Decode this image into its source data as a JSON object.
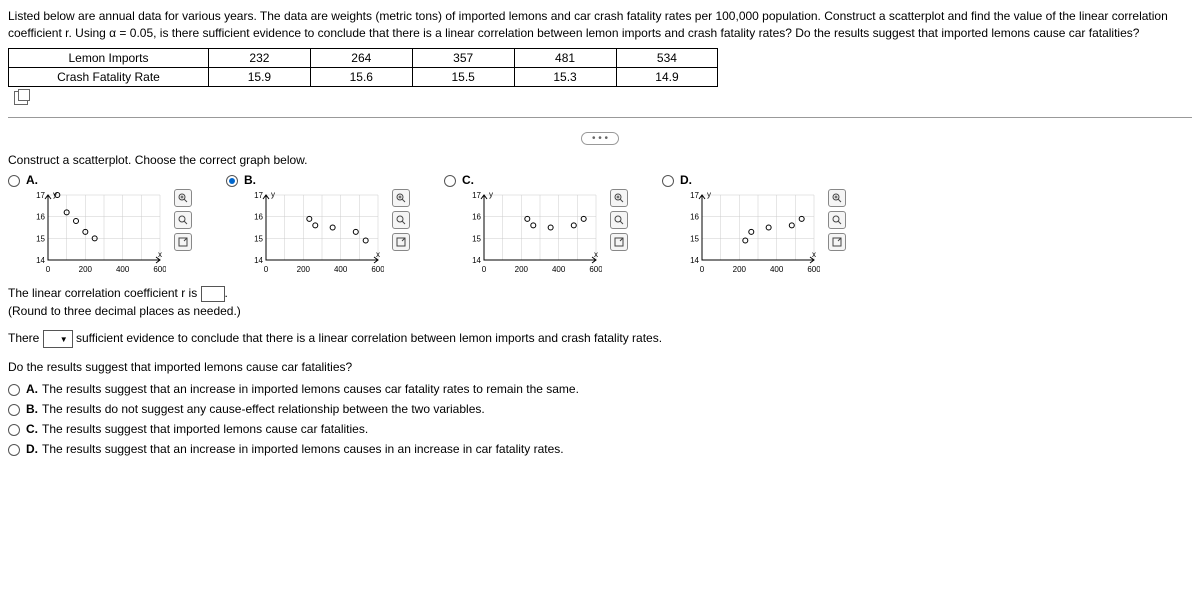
{
  "intro": "Listed below are annual data for various years. The data are weights (metric tons) of imported lemons and car crash fatality rates per 100,000 population. Construct a scatterplot and find the value of the linear correlation coefficient r. Using α = 0.05, is there sufficient evidence to conclude that there is a linear correlation between lemon imports and crash fatality rates? Do the results suggest that imported lemons cause car fatalities?",
  "table": {
    "rows": [
      {
        "label": "Lemon Imports",
        "values": [
          "232",
          "264",
          "357",
          "481",
          "534"
        ]
      },
      {
        "label": "Crash Fatality Rate",
        "values": [
          "15.9",
          "15.6",
          "15.5",
          "15.3",
          "14.9"
        ]
      }
    ]
  },
  "q1": "Construct a scatterplot. Choose the correct graph below.",
  "options": [
    {
      "letter": "A.",
      "selected": false
    },
    {
      "letter": "B.",
      "selected": true
    },
    {
      "letter": "C.",
      "selected": false
    },
    {
      "letter": "D.",
      "selected": false
    }
  ],
  "axis": {
    "y": "y",
    "x": "x",
    "yticks": [
      "17",
      "16",
      "15",
      "14"
    ],
    "xticks": [
      "0",
      "200",
      "400",
      "600"
    ]
  },
  "chart_data": [
    {
      "type": "scatter",
      "title": "A",
      "xlim": [
        0,
        600
      ],
      "ylim": [
        14,
        17
      ],
      "x": [
        50,
        100,
        150,
        200,
        250
      ],
      "y": [
        17,
        16.2,
        15.8,
        15.3,
        15
      ]
    },
    {
      "type": "scatter",
      "title": "B",
      "xlim": [
        0,
        600
      ],
      "ylim": [
        14,
        17
      ],
      "x": [
        232,
        264,
        357,
        481,
        534
      ],
      "y": [
        15.9,
        15.6,
        15.5,
        15.3,
        14.9
      ]
    },
    {
      "type": "scatter",
      "title": "C",
      "xlim": [
        0,
        600
      ],
      "ylim": [
        14,
        17
      ],
      "x": [
        232,
        264,
        357,
        481,
        534
      ],
      "y": [
        15.9,
        15.6,
        15.5,
        15.6,
        15.9
      ]
    },
    {
      "type": "scatter",
      "title": "D",
      "xlim": [
        0,
        600
      ],
      "ylim": [
        14,
        17
      ],
      "x": [
        232,
        264,
        357,
        481,
        534
      ],
      "y": [
        14.9,
        15.3,
        15.5,
        15.6,
        15.9
      ]
    }
  ],
  "answer1_prefix": "The linear correlation coefficient r is ",
  "answer1_suffix": ".",
  "hint1": "(Round to three decimal places as needed.)",
  "sentence2_prefix": "There ",
  "sentence2_suffix": " sufficient evidence to conclude that there is a linear correlation between lemon imports and crash fatality rates.",
  "q3": "Do the results suggest that imported lemons cause car fatalities?",
  "mc": [
    {
      "letter": "A.",
      "text": "The results suggest that an increase in imported lemons causes car fatality rates to remain the same."
    },
    {
      "letter": "B.",
      "text": "The results do not suggest any cause-effect relationship between the two variables."
    },
    {
      "letter": "C.",
      "text": "The results suggest that imported lemons cause car fatalities."
    },
    {
      "letter": "D.",
      "text": "The results suggest that an increase in imported lemons causes in an increase in car fatality rates."
    }
  ]
}
